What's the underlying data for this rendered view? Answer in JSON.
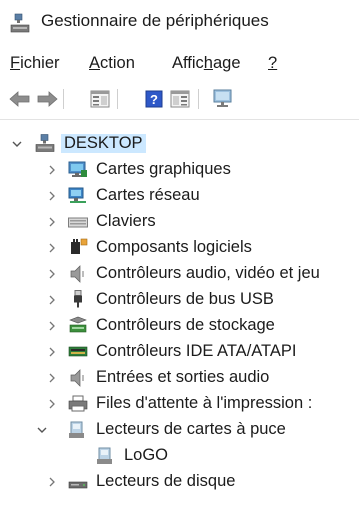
{
  "window": {
    "title": "Gestionnaire de périphériques"
  },
  "menu": {
    "file": {
      "label": "Fichier",
      "mnemonic": "F",
      "rest": "ichier"
    },
    "action": {
      "label": "Action",
      "mnemonic": "A",
      "rest": "ction"
    },
    "view": {
      "label": "Affichage",
      "before": "Affic",
      "mnemonic": "h",
      "after": "age"
    },
    "help": {
      "label": "?"
    }
  },
  "toolbar": {
    "icons": [
      "back-arrow-icon",
      "forward-arrow-icon",
      "properties-icon",
      "help-icon",
      "show-hidden-icon",
      "monitor-icon"
    ]
  },
  "tree": {
    "root": {
      "label": "DESKTOP",
      "expanded": true,
      "icon": "computer-icon"
    },
    "categories": [
      {
        "label": "Cartes graphiques",
        "icon": "display-adapter-icon",
        "expanded": false
      },
      {
        "label": "Cartes réseau",
        "icon": "network-adapter-icon",
        "expanded": false
      },
      {
        "label": "Claviers",
        "icon": "keyboard-icon",
        "expanded": false
      },
      {
        "label": "Composants logiciels",
        "icon": "software-component-icon",
        "expanded": false
      },
      {
        "label": "Contrôleurs audio, vidéo et jeu",
        "icon": "speaker-icon",
        "expanded": false
      },
      {
        "label": "Contrôleurs de bus USB",
        "icon": "usb-plug-icon",
        "expanded": false
      },
      {
        "label": "Contrôleurs de stockage",
        "icon": "storage-controller-icon",
        "expanded": false
      },
      {
        "label": "Contrôleurs IDE ATA/ATAPI",
        "icon": "ide-controller-icon",
        "expanded": false
      },
      {
        "label": "Entrées et sorties audio",
        "icon": "speaker-icon",
        "expanded": false
      },
      {
        "label": "Files d'attente à l'impression :",
        "icon": "printer-icon",
        "expanded": false
      },
      {
        "label": "Lecteurs de cartes à puce",
        "icon": "smart-card-reader-icon",
        "expanded": true
      },
      {
        "label": "LoGO",
        "icon": "smart-card-reader-icon",
        "child": true
      },
      {
        "label": "Lecteurs de disque",
        "icon": "disk-drive-icon",
        "expanded": false
      }
    ]
  }
}
